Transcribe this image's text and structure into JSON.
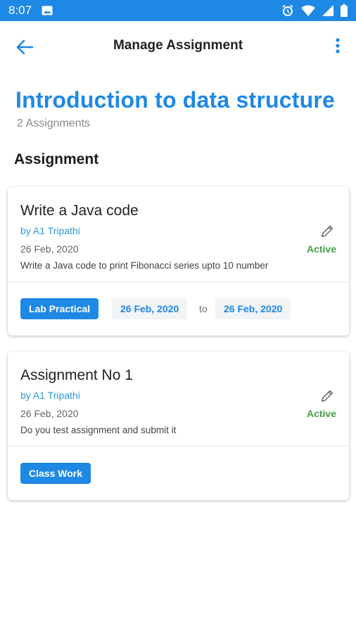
{
  "status_bar": {
    "time": "8:07",
    "icons": [
      "image-icon",
      "alarm-icon",
      "wifi-icon",
      "signal-icon",
      "battery-icon"
    ]
  },
  "app_bar": {
    "title": "Manage Assignment",
    "back_icon": "arrow-back-icon",
    "menu_icon": "more-vert-icon"
  },
  "course": {
    "title": "Introduction to data structure",
    "count": "2 Assignments"
  },
  "section_title": "Assignment",
  "assignments": [
    {
      "name": "Write a Java code",
      "by": "by A1 Tripathi",
      "date": "26 Feb, 2020",
      "description": "Write a Java code to print Fibonacci series upto 10 number",
      "status": "Active",
      "type": "Lab Practical",
      "from": "26 Feb, 2020",
      "to_label": "to",
      "to": "26 Feb, 2020"
    },
    {
      "name": "Assignment No 1",
      "by": "by A1 Tripathi",
      "date": "26 Feb, 2020",
      "description": "Do you test assignment and submit it",
      "status": "Active",
      "type": "Class Work"
    }
  ],
  "colors": {
    "primary": "#1e88e5",
    "link": "#2b9bd6",
    "active": "#43a047"
  }
}
